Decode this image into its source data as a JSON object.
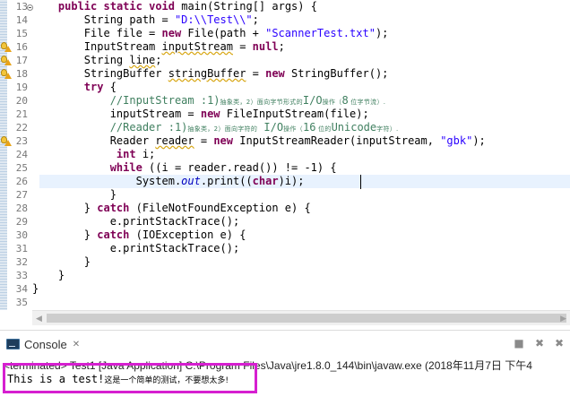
{
  "editor": {
    "line_numbers": [
      "13",
      "14",
      "15",
      "16",
      "17",
      "18",
      "19",
      "20",
      "21",
      "22",
      "23",
      "24",
      "25",
      "26",
      "27",
      "28",
      "29",
      "30",
      "31",
      "32",
      "33",
      "34",
      "35"
    ],
    "lines": [
      [
        {
          "t": "    "
        },
        {
          "t": "public",
          "c": "kw"
        },
        {
          "t": " "
        },
        {
          "t": "static",
          "c": "kw"
        },
        {
          "t": " "
        },
        {
          "t": "void",
          "c": "kw"
        },
        {
          "t": " main(String[] args) {"
        }
      ],
      [
        {
          "t": "        String path = "
        },
        {
          "t": "\"D:\\\\Test\\\\\"",
          "c": "str"
        },
        {
          "t": ";"
        }
      ],
      [
        {
          "t": "        File file = "
        },
        {
          "t": "new",
          "c": "kw"
        },
        {
          "t": " File(path + "
        },
        {
          "t": "\"ScannerTest.txt\"",
          "c": "str"
        },
        {
          "t": ");"
        }
      ],
      [
        {
          "t": "        InputStream "
        },
        {
          "t": "inputStream",
          "c": "sq"
        },
        {
          "t": " = "
        },
        {
          "t": "null",
          "c": "kw"
        },
        {
          "t": ";"
        }
      ],
      [
        {
          "t": "        String "
        },
        {
          "t": "line",
          "c": "sq"
        },
        {
          "t": ";"
        }
      ],
      [
        {
          "t": "        StringBuffer "
        },
        {
          "t": "stringBuffer",
          "c": "sq"
        },
        {
          "t": " = "
        },
        {
          "t": "new",
          "c": "kw"
        },
        {
          "t": " StringBuffer();"
        }
      ],
      [
        {
          "t": "        "
        },
        {
          "t": "try",
          "c": "kw"
        },
        {
          "t": " {"
        }
      ],
      [
        {
          "t": "            "
        },
        {
          "t": "//InputStream :1)",
          "c": "cmt"
        },
        {
          "t": "抽象类，2）面向字节形式的",
          "c": "cjk"
        },
        {
          "t": "I/O",
          "c": "cmt"
        },
        {
          "t": "操作（",
          "c": "cjk"
        },
        {
          "t": "8",
          "c": "cmt"
        },
        {
          "t": " 位字节流）.",
          "c": "cjk"
        }
      ],
      [
        {
          "t": "            inputStream = "
        },
        {
          "t": "new",
          "c": "kw"
        },
        {
          "t": " FileInputStream(file);"
        }
      ],
      [
        {
          "t": "            "
        },
        {
          "t": "//Reader :1)",
          "c": "cmt"
        },
        {
          "t": "抽象类，2）面向字符的",
          "c": "cjk"
        },
        {
          "t": " I/O",
          "c": "cmt"
        },
        {
          "t": "操作（",
          "c": "cjk"
        },
        {
          "t": "16",
          "c": "cmt"
        },
        {
          "t": " 位的",
          "c": "cjk"
        },
        {
          "t": "Unicode",
          "c": "cmt"
        },
        {
          "t": "字符）.",
          "c": "cjk"
        }
      ],
      [
        {
          "t": "            Reader "
        },
        {
          "t": "reader",
          "c": "sq"
        },
        {
          "t": " = "
        },
        {
          "t": "new",
          "c": "kw"
        },
        {
          "t": " InputStreamReader(inputStream, "
        },
        {
          "t": "\"gbk\"",
          "c": "str"
        },
        {
          "t": ");"
        }
      ],
      [
        {
          "t": "             "
        },
        {
          "t": "int",
          "c": "kw"
        },
        {
          "t": " i;"
        }
      ],
      [
        {
          "t": "            "
        },
        {
          "t": "while",
          "c": "kw"
        },
        {
          "t": " ((i = reader.read()) != -1) {"
        }
      ],
      [
        {
          "t": "                System."
        },
        {
          "t": "out",
          "c": "fld"
        },
        {
          "t": ".print(("
        },
        {
          "t": "char",
          "c": "kw"
        },
        {
          "t": ")i);"
        }
      ],
      [
        {
          "t": "            }"
        }
      ],
      [
        {
          "t": "        } "
        },
        {
          "t": "catch",
          "c": "kw"
        },
        {
          "t": " (FileNotFoundException e) {"
        }
      ],
      [
        {
          "t": "            e.printStackTrace();"
        }
      ],
      [
        {
          "t": "        } "
        },
        {
          "t": "catch",
          "c": "kw"
        },
        {
          "t": " (IOException e) {"
        }
      ],
      [
        {
          "t": "            e.printStackTrace();"
        }
      ],
      [
        {
          "t": "        }"
        }
      ],
      [
        {
          "t": "    }"
        }
      ],
      [
        {
          "t": "}"
        }
      ],
      [
        {
          "t": ""
        }
      ]
    ],
    "fold_lines": [
      "13"
    ],
    "warning_lines": [
      "16",
      "17",
      "18",
      "23"
    ],
    "highlighted_line": "26"
  },
  "console": {
    "tab_label": "Console",
    "tab_close": "✕",
    "icons": [
      "console-icon",
      "clear-console-icon",
      "remove-launch-icon",
      "remove-all-terminated-icon"
    ],
    "terminated_text": "<terminated> Test1 [Java Application] C:\\Program Files\\Java\\jre1.8.0_144\\bin\\javaw.exe (2018年11月7日 下午4",
    "output_latin": "This is a test!",
    "output_cn": "这是一个简单的测试，不要想太多!",
    "highlight_color": "#d61fd0"
  }
}
